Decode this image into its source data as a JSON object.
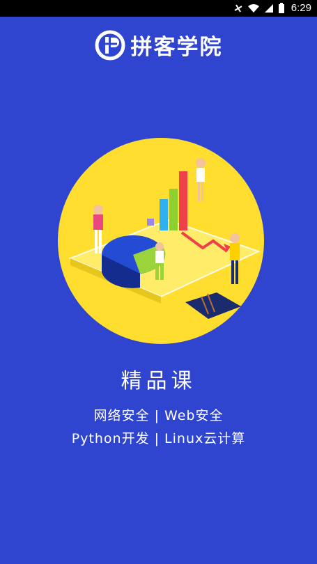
{
  "status_bar": {
    "time": "6:29",
    "icons": [
      "mute-icon",
      "wifi-icon",
      "signal-icon",
      "battery-icon"
    ]
  },
  "brand": {
    "title": "拼客学院",
    "logo_icon": "ip-logo-icon"
  },
  "illustration": {
    "icon": "analytics-illustration-icon",
    "background_color": "#ffde2f"
  },
  "section": {
    "title": "精品课"
  },
  "courses": {
    "line1": "网络安全 | Web安全",
    "line2": "Python开发 | Linux云计算"
  },
  "colors": {
    "background": "#2f45cf",
    "text": "#ffffff",
    "status_bar": "#000000"
  }
}
